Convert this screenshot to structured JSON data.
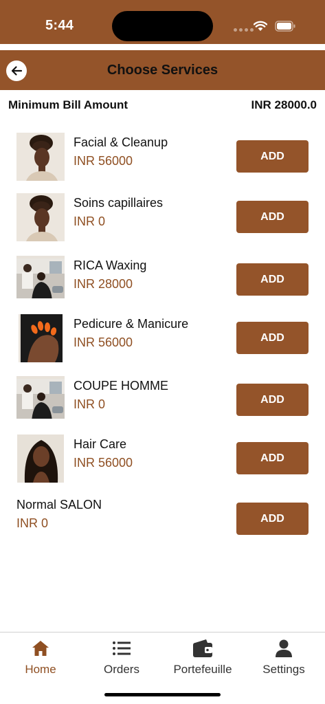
{
  "status_bar": {
    "time": "5:44"
  },
  "header": {
    "title": "Choose Services"
  },
  "min_bill": {
    "label": "Minimum Bill Amount",
    "value": "INR 28000.0"
  },
  "services": [
    {
      "name": "Facial & Cleanup",
      "price": "INR 56000",
      "add_label": "ADD",
      "image": "woman-updo-photo"
    },
    {
      "name": "Soins capillaires",
      "price": "INR 0",
      "add_label": "ADD",
      "image": "woman-updo-photo"
    },
    {
      "name": "RICA Waxing",
      "price": "INR 28000",
      "add_label": "ADD",
      "image": "barbershop-photo"
    },
    {
      "name": "Pedicure & Manicure",
      "price": "INR 56000",
      "add_label": "ADD",
      "image": "orange-nails-photo"
    },
    {
      "name": "COUPE HOMME",
      "price": "INR 0",
      "add_label": "ADD",
      "image": "barbershop-photo"
    },
    {
      "name": "Hair Care",
      "price": "INR 56000",
      "add_label": "ADD",
      "image": "woman-long-hair-photo"
    },
    {
      "name": "Normal SALON",
      "price": "INR 0",
      "add_label": "ADD",
      "image": ""
    }
  ],
  "tabs": [
    {
      "label": "Home",
      "icon": "home-icon",
      "active": true
    },
    {
      "label": "Orders",
      "icon": "list-icon",
      "active": false
    },
    {
      "label": "Portefeuille",
      "icon": "wallet-icon",
      "active": false
    },
    {
      "label": "Settings",
      "icon": "person-icon",
      "active": false
    }
  ],
  "colors": {
    "brand": "#94542a",
    "price": "#8f4f22",
    "tab_active": "#8f4f22"
  }
}
